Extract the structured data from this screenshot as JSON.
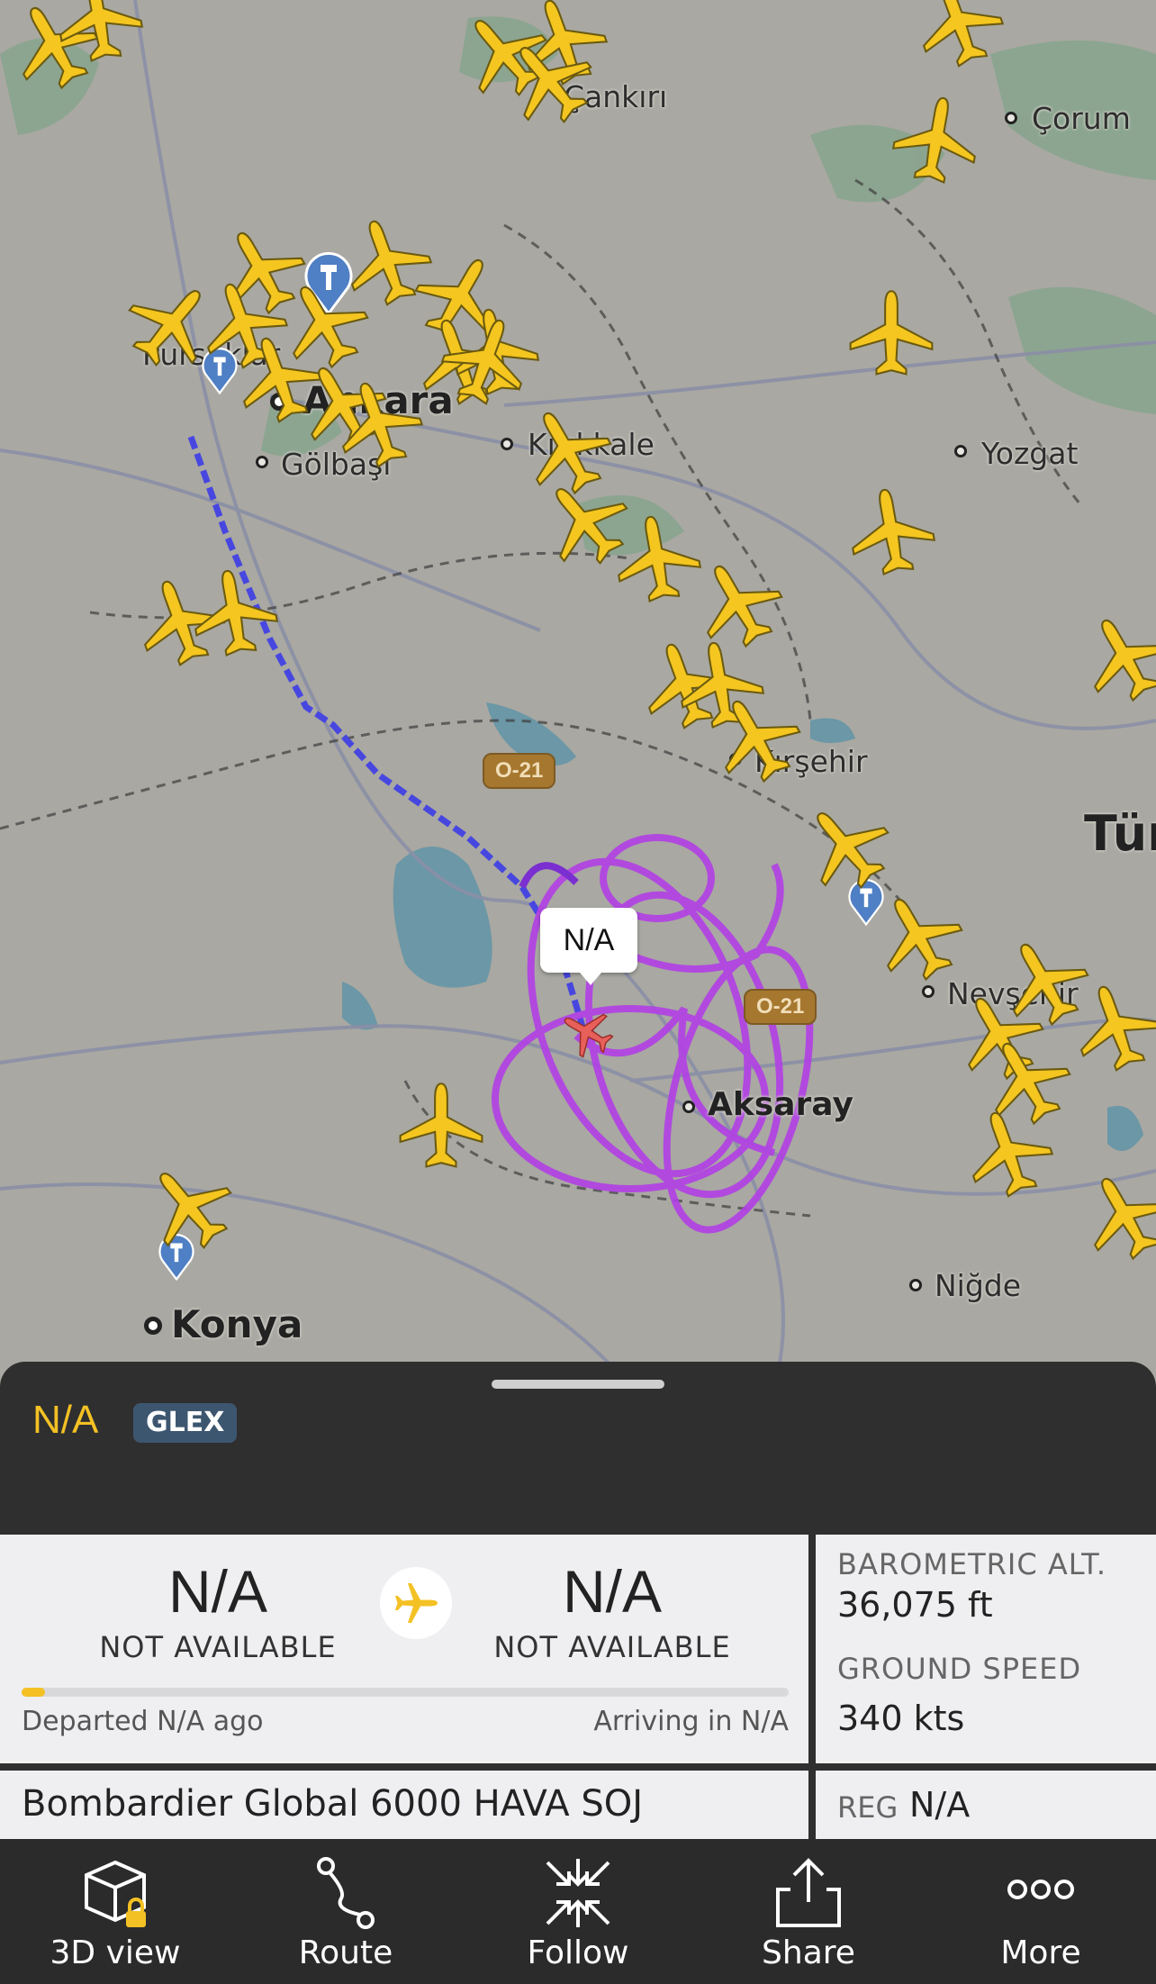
{
  "map": {
    "cities": [
      {
        "name": "Çankırı"
      },
      {
        "name": "Çorum"
      },
      {
        "name": "Pursaklar"
      },
      {
        "name": "Ankara"
      },
      {
        "name": "Gölbaşı"
      },
      {
        "name": "Kırıkkale"
      },
      {
        "name": "Yozgat"
      },
      {
        "name": "Kırşehir"
      },
      {
        "name": "Tür"
      },
      {
        "name": "Nevşehir"
      },
      {
        "name": "Aksaray"
      },
      {
        "name": "Niğde"
      },
      {
        "name": "Konya"
      }
    ],
    "road_shields": [
      "O-21",
      "O-21"
    ],
    "selected_label": "N/A",
    "colors": {
      "plane": "#f4c61f",
      "selected_plane": "#e8605a",
      "track_blue": "#4a4ae6",
      "track_purple": "#b23fe6",
      "tower": "#4f7fc4"
    }
  },
  "sheet": {
    "callsign": "N/A",
    "type_code": "GLEX"
  },
  "route": {
    "origin_code": "N/A",
    "origin_name": "NOT AVAILABLE",
    "destination_code": "N/A",
    "destination_name": "NOT AVAILABLE",
    "progress_fraction": 0.03,
    "departed_text": "Departed N/A ago",
    "arriving_text": "Arriving in N/A",
    "icon": "airplane-icon"
  },
  "stats": {
    "baro_label": "BAROMETRIC ALT.",
    "baro_value": "36,075 ft",
    "speed_label": "GROUND SPEED",
    "speed_value": "340 kts"
  },
  "aircraft": {
    "type_name": "Bombardier Global 6000 HAVA SOJ",
    "reg_label": "REG",
    "reg_value": "N/A"
  },
  "bottom_bar": [
    {
      "label": "3D view",
      "icon": "cube-lock-icon"
    },
    {
      "label": "Route",
      "icon": "route-icon"
    },
    {
      "label": "Follow",
      "icon": "follow-icon"
    },
    {
      "label": "Share",
      "icon": "share-icon"
    },
    {
      "label": "More",
      "icon": "more-dots-icon"
    }
  ]
}
